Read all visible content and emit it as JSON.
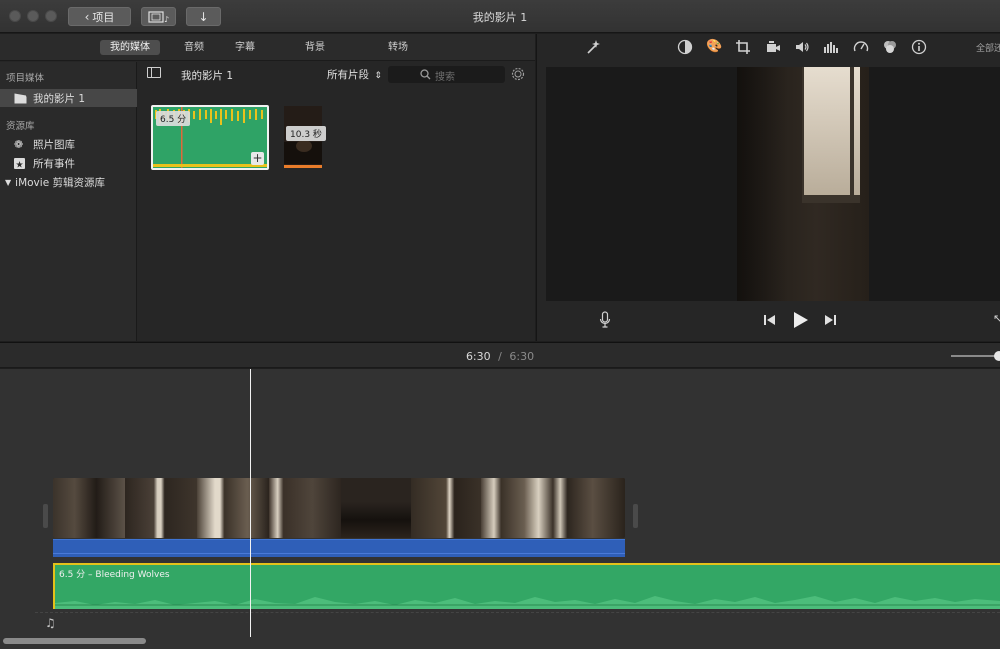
{
  "window": {
    "title": "我的影片 1",
    "back_label": "项目",
    "download_icon": "down-arrow-icon",
    "media_view_icon": "film-music-icon"
  },
  "media_tabs": [
    {
      "label": "我的媒体",
      "active": true
    },
    {
      "label": "音频",
      "active": false
    },
    {
      "label": "字幕",
      "active": false
    },
    {
      "label": "背景",
      "active": false
    },
    {
      "label": "转场",
      "active": false
    }
  ],
  "sidebar": {
    "project_media_header": "项目媒体",
    "project_item": "我的影片 1",
    "libraries_header": "资源库",
    "photo_library": "照片图库",
    "all_events": "所有事件",
    "imovie_library": "iMovie 剪辑资源库"
  },
  "browser": {
    "current_title": "我的影片 1",
    "filter_label": "所有片段",
    "search_placeholder": "搜索",
    "clips": [
      {
        "duration": "6.5 分",
        "kind": "audio"
      },
      {
        "duration": "10.3 秒",
        "kind": "video"
      }
    ]
  },
  "viewer": {
    "reset_all_label": "全部还",
    "adjust_icons": [
      "magic-wand-icon",
      "color-balance-icon",
      "color-palette-icon",
      "crop-icon",
      "stabilization-camera-icon",
      "volume-icon",
      "equalizer-icon",
      "speed-icon",
      "clip-filter-icon",
      "info-icon"
    ]
  },
  "timeline": {
    "current_time": "6:30",
    "separator": "/",
    "total_time": "6:30",
    "music_clip_label": "6.5 分 –  Bleeding Wolves"
  },
  "colors": {
    "accent_green": "#33a765",
    "audio_blue": "#2f5fb8",
    "selection_yellow": "#e3c21a"
  }
}
